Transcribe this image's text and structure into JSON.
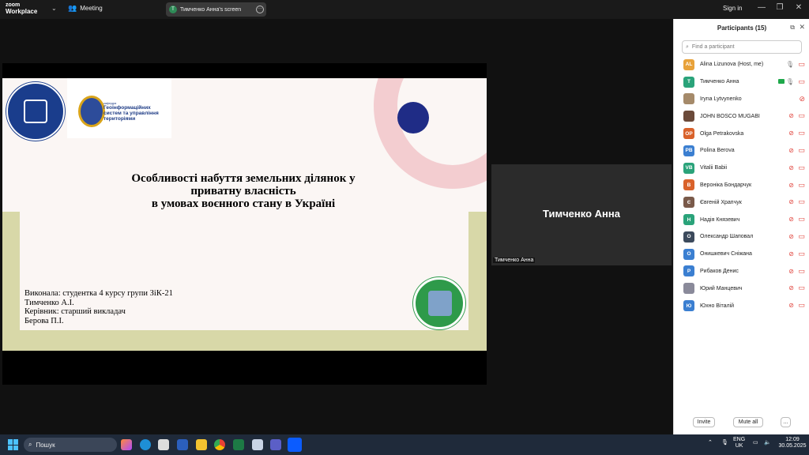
{
  "titlebar": {
    "brand_line1": "zoom",
    "brand_line2": "Workplace",
    "meeting_label": "Meeting",
    "share_label": "Тимченко Анна's screen",
    "share_initial": "Т",
    "signin_label": "Sign in",
    "minimize": "—",
    "restore": "❐",
    "close": "✕"
  },
  "slide": {
    "dept_small": "кафедра",
    "dept_line1": "Геоінформаційних",
    "dept_line2": "систем та управління",
    "dept_line3": "територіями",
    "title_line1": "Особливості набуття земельних ділянок у",
    "title_line2": "приватну власність",
    "title_line3": "в умовах воєнного стану в Україні",
    "author_line1": "Виконала: студентка 4 курсу групи ЗіК-21",
    "author_line2": "Тимченко А.І.",
    "author_line3": "Керівник: старший викладач",
    "author_line4": "Берова П.І."
  },
  "video_tile": {
    "display_name": "Тимченко Анна",
    "label": "Тимченко Анна"
  },
  "panel": {
    "title": "Participants (15)",
    "search_placeholder": "Find a participant",
    "invite_label": "Invite",
    "mute_all_label": "Mute all",
    "more_label": "…",
    "participants": [
      {
        "initials": "AL",
        "name": "Alina Lizunova (Host, me)",
        "color": "#e8a23a"
      },
      {
        "initials": "Т",
        "name": "Тимченко Анна",
        "color": "#2aa37a"
      },
      {
        "initials": "",
        "name": "Iryna Lytvynenko",
        "color": "#a58a6a"
      },
      {
        "initials": "",
        "name": "JOHN BOSCO MUGABI",
        "color": "#6b4a3a"
      },
      {
        "initials": "OP",
        "name": "Olga Petrakovska",
        "color": "#d9622b"
      },
      {
        "initials": "PB",
        "name": "Polina Berova",
        "color": "#3b7fd1"
      },
      {
        "initials": "VB",
        "name": "Vitalii Babii",
        "color": "#2aa37a"
      },
      {
        "initials": "В",
        "name": "Вероніка Бондарчук",
        "color": "#d9622b"
      },
      {
        "initials": "Є",
        "name": "Євгеній Храпчук",
        "color": "#7a5a4a"
      },
      {
        "initials": "Н",
        "name": "Надія Князевич",
        "color": "#2aa37a"
      },
      {
        "initials": "О",
        "name": "Олександр Шаповал",
        "color": "#3c4a5c"
      },
      {
        "initials": "О",
        "name": "Онишкевич Сніжана",
        "color": "#3b7fd1"
      },
      {
        "initials": "Р",
        "name": "Рибаков Денис",
        "color": "#3b7fd1"
      },
      {
        "initials": "",
        "name": "Юрий Манцевич",
        "color": "#8a8a9a"
      },
      {
        "initials": "Ю",
        "name": "Юхно Віталій",
        "color": "#3b7fd1"
      }
    ]
  },
  "taskbar": {
    "search_label": "Пошук",
    "lang_line1": "ENG",
    "lang_line2": "UK",
    "time": "12:09",
    "date": "30.05.2025"
  }
}
